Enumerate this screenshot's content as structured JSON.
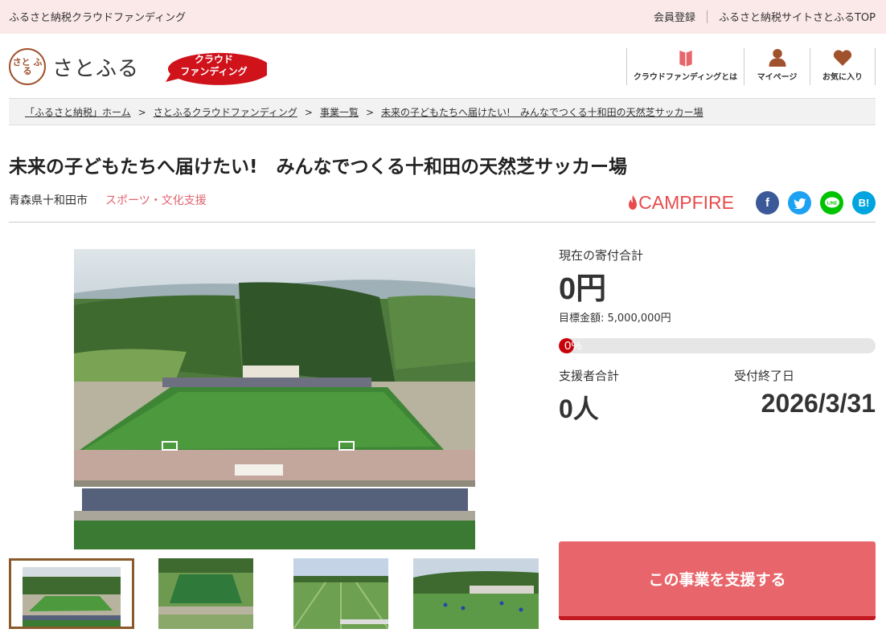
{
  "topbar": {
    "site_name": "ふるさと納税クラウドファンディング",
    "register": "会員登録",
    "satofull_top": "ふるさと納税サイトさとふるTOP"
  },
  "header": {
    "logo_seal": "さと ふる",
    "logo_text": "さとふる",
    "cf_badge_line1": "クラウド",
    "cf_badge_line2": "ファンディング",
    "nav": [
      {
        "label": "クラウドファンディングとは",
        "icon": "book-icon"
      },
      {
        "label": "マイページ",
        "icon": "user-icon"
      },
      {
        "label": "お気に入り",
        "icon": "heart-icon"
      }
    ]
  },
  "breadcrumb": {
    "items": [
      "「ふるさと納税」ホーム",
      "さとふるクラウドファンディング",
      "事業一覧",
      "未来の子どもたちへ届けたい!　みんなでつくる十和田の天然芝サッカー場"
    ],
    "separator": ">"
  },
  "project": {
    "title": "未来の子どもたちへ届けたい!　みんなでつくる十和田の天然芝サッカー場",
    "location": "青森県十和田市",
    "category": "スポーツ・文化支援"
  },
  "share": {
    "campfire": "CAMPFIRE",
    "facebook": "f",
    "line": "LINE",
    "hatena": "B!"
  },
  "stats": {
    "total_label": "現在の寄付合計",
    "total_value": "0円",
    "goal_text": "目標金額: 5,000,000円",
    "progress_pct_text": "0%",
    "progress_fraction": 0,
    "supporters_label": "支援者合計",
    "supporters_value": "0人",
    "deadline_label": "受付終了日",
    "deadline_value": "2026/3/31"
  },
  "support_button": "この事業を支援する",
  "colors": {
    "topbar_bg": "#fbe9ea",
    "accent_red": "#e8666b",
    "category_pink": "#e06470",
    "progress_red": "#c8000a",
    "campfire_red": "#e74b4b",
    "facebook": "#3b5998",
    "twitter": "#1da1f2",
    "line": "#00c300",
    "hatena": "#00a4de"
  }
}
